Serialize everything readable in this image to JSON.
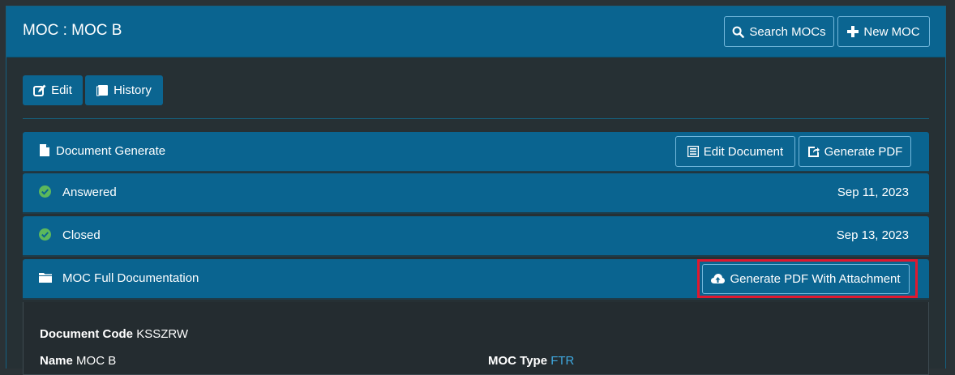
{
  "header": {
    "title": "MOC : MOC B",
    "search_label": "Search MOCs",
    "new_label": "New MOC"
  },
  "toolbar": {
    "edit_label": "Edit",
    "history_label": "History"
  },
  "sections": {
    "document_generate": {
      "label": "Document Generate",
      "edit_document_label": "Edit Document",
      "generate_pdf_label": "Generate PDF"
    },
    "answered": {
      "label": "Answered",
      "date": "Sep 11, 2023"
    },
    "closed": {
      "label": "Closed",
      "date": "Sep 13, 2023"
    },
    "full_documentation": {
      "label": "MOC Full Documentation",
      "generate_with_attachment_label": "Generate PDF With Attachment"
    }
  },
  "details": {
    "document_code_label": "Document Code",
    "document_code_value": "KSSZRW",
    "name_label": "Name",
    "name_value": "MOC B",
    "moc_type_label": "MOC Type",
    "moc_type_value": "FTR"
  },
  "colors": {
    "header_bg": "#0a6490",
    "page_bg": "#263034",
    "status_check": "#5cb85c",
    "link": "#3fa9e0",
    "highlight": "#e0182f"
  },
  "icons": {
    "search": "search-icon",
    "new": "plus-icon",
    "edit": "edit-icon",
    "history": "book-icon",
    "document": "file-icon",
    "edit_document": "list-icon",
    "generate_pdf": "export-icon",
    "status": "check-circle-icon",
    "folder": "folder-icon",
    "upload": "cloud-upload-icon"
  }
}
